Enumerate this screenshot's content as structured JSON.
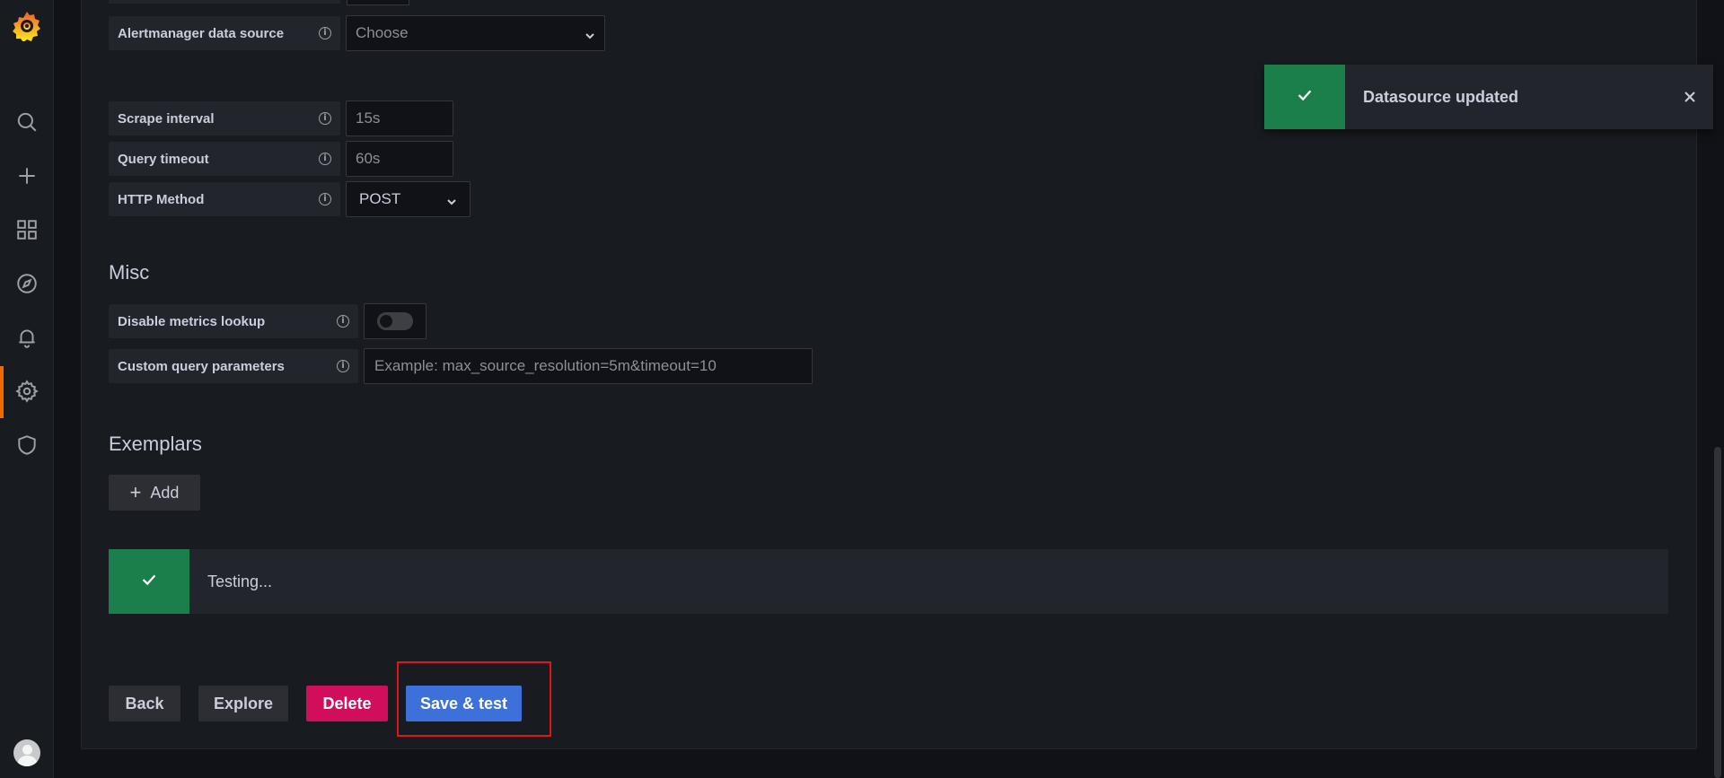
{
  "sidebar": {
    "items": [
      "search-icon",
      "plus-icon",
      "dashboards-icon",
      "explore-icon",
      "alerting-icon",
      "configuration-icon",
      "shield-icon"
    ],
    "active": "configuration-icon"
  },
  "fields": {
    "alertmanager": {
      "label": "Alertmanager data source",
      "value": "Choose"
    },
    "scrape_interval": {
      "label": "Scrape interval",
      "placeholder": "15s"
    },
    "query_timeout": {
      "label": "Query timeout",
      "placeholder": "60s"
    },
    "http_method": {
      "label": "HTTP Method",
      "value": "POST"
    }
  },
  "misc": {
    "title": "Misc",
    "disable_metrics": {
      "label": "Disable metrics lookup",
      "enabled": false
    },
    "custom_query": {
      "label": "Custom query parameters",
      "placeholder": "Example: max_source_resolution=5m&timeout=10"
    }
  },
  "exemplars": {
    "title": "Exemplars",
    "add_label": "Add"
  },
  "alert": {
    "text": "Testing..."
  },
  "buttons": {
    "back": "Back",
    "explore": "Explore",
    "delete": "Delete",
    "save_test": "Save & test"
  },
  "toast": {
    "text": "Datasource updated"
  },
  "colors": {
    "success": "#1a7f4b",
    "primary": "#3d71d9",
    "danger": "#d10e5c",
    "accent": "#f46800"
  }
}
